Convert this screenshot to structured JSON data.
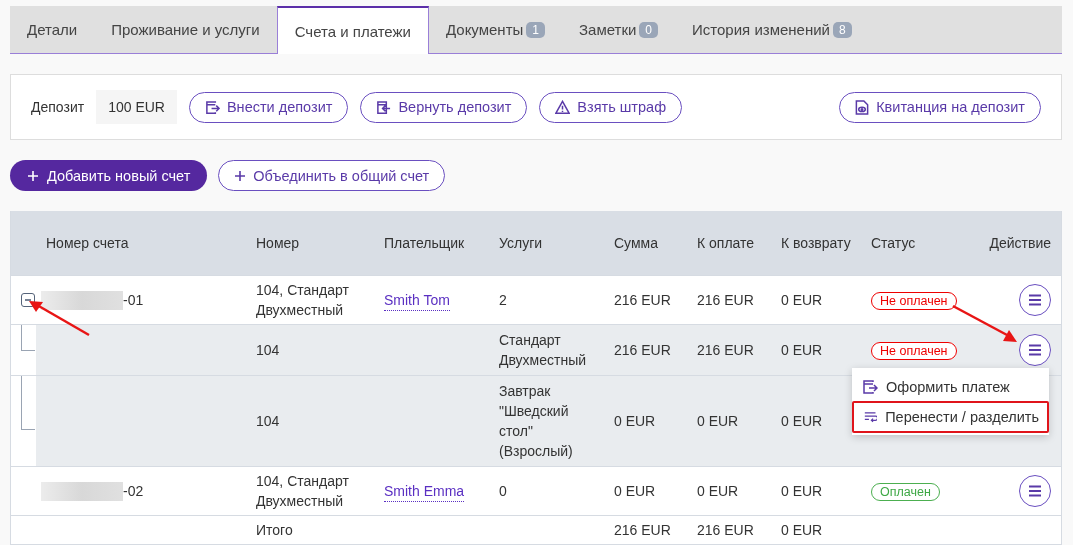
{
  "tabs": [
    {
      "label": "Детали",
      "selected": false
    },
    {
      "label": "Проживание и услуги",
      "selected": false
    },
    {
      "label": "Счета и платежи",
      "selected": true
    },
    {
      "label": "Документы",
      "count": "1",
      "selected": false
    },
    {
      "label": "Заметки",
      "count": "0",
      "selected": false
    },
    {
      "label": "История изменений",
      "count": "8",
      "selected": false
    }
  ],
  "deposit": {
    "label": "Депозит",
    "value": "100 EUR",
    "actions": [
      {
        "label": "Внести депозит",
        "kind": "in"
      },
      {
        "label": "Вернуть депозит",
        "kind": "out"
      },
      {
        "label": "Взять штраф",
        "kind": "fine"
      }
    ],
    "receipt": {
      "label": "Квитанция на депозит",
      "kind": "receipt"
    }
  },
  "toolbar": [
    {
      "label": "Добавить новый счет",
      "primary": true
    },
    {
      "label": "Объединить в общий счет",
      "primary": false
    }
  ],
  "table": {
    "columns": [
      "Номер счета",
      "Номер",
      "Плательщик",
      "Услуги",
      "Сумма",
      "К оплате",
      "К возврату",
      "Статус",
      "Действие"
    ],
    "rows": [
      {
        "redacted": true,
        "number_suffix": "-01",
        "expanded": true,
        "pointer": true,
        "room": "104, Стандарт Двухместный",
        "payer": "Smith Tom",
        "services": "2",
        "sum": "216 EUR",
        "due": "216 EUR",
        "refund": "0 EUR",
        "status": {
          "label": "Не оплачен",
          "paid": false
        },
        "children": [
          {
            "room": "104",
            "services": "Стандарт Двухместный",
            "sum": "216 EUR",
            "due": "216 EUR",
            "refund": "0 EUR",
            "status": {
              "label": "Не оплачен",
              "paid": false
            },
            "pointer": true,
            "menu": [
              {
                "label": "Оформить платеж",
                "kind": "pay",
                "highlighted": false
              },
              {
                "label": "Перенести / разделить",
                "kind": "split",
                "highlighted": true
              }
            ]
          },
          {
            "room": "104",
            "services": "Завтрак \"Шведский стол\" (Взрослый)",
            "sum": "0 EUR",
            "due": "0 EUR",
            "refund": "0 EUR"
          }
        ]
      },
      {
        "redacted": true,
        "number_suffix": "-02",
        "pointer": false,
        "room": "104, Стандарт Двухместный",
        "payer": "Smith Emma",
        "services": "0",
        "sum": "0 EUR",
        "due": "0 EUR",
        "refund": "0 EUR",
        "status": {
          "label": "Оплачен",
          "paid": true
        }
      }
    ],
    "total": {
      "label": "Итого",
      "sum": "216 EUR",
      "due": "216 EUR",
      "refund": "0 EUR"
    }
  }
}
